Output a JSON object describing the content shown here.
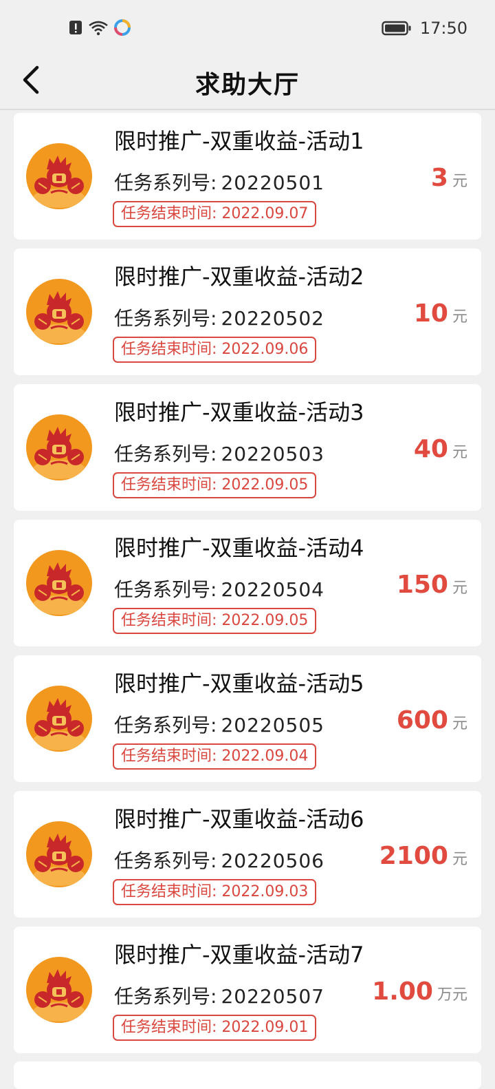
{
  "status_bar": {
    "time": "17:50"
  },
  "header": {
    "title": "求助大厅"
  },
  "tasks": [
    {
      "title": "限时推广-双重收益-活动1",
      "serial_label": "任务系列号:",
      "serial": "20220501",
      "deadline": "任务结束时间: 2022.09.07",
      "amount": "3",
      "unit": "元"
    },
    {
      "title": "限时推广-双重收益-活动2",
      "serial_label": "任务系列号:",
      "serial": "20220502",
      "deadline": "任务结束时间: 2022.09.06",
      "amount": "10",
      "unit": "元"
    },
    {
      "title": "限时推广-双重收益-活动3",
      "serial_label": "任务系列号:",
      "serial": "20220503",
      "deadline": "任务结束时间: 2022.09.05",
      "amount": "40",
      "unit": "元"
    },
    {
      "title": "限时推广-双重收益-活动4",
      "serial_label": "任务系列号:",
      "serial": "20220504",
      "deadline": "任务结束时间: 2022.09.05",
      "amount": "150",
      "unit": "元"
    },
    {
      "title": "限时推广-双重收益-活动5",
      "serial_label": "任务系列号:",
      "serial": "20220505",
      "deadline": "任务结束时间: 2022.09.04",
      "amount": "600",
      "unit": "元"
    },
    {
      "title": "限时推广-双重收益-活动6",
      "serial_label": "任务系列号:",
      "serial": "20220506",
      "deadline": "任务结束时间: 2022.09.03",
      "amount": "2100",
      "unit": "元"
    },
    {
      "title": "限时推广-双重收益-活动7",
      "serial_label": "任务系列号:",
      "serial": "20220507",
      "deadline": "任务结束时间: 2022.09.01",
      "amount": "1.00",
      "unit": "万元"
    }
  ],
  "icons": {
    "back": "chevron-left-icon",
    "avatar": "mascot-avatar-icon",
    "battery": "battery-icon",
    "wifi": "wifi-icon",
    "alert": "alert-icon"
  },
  "colors": {
    "accent": "#e04a3f",
    "avatar_bg": "#f2981f"
  }
}
